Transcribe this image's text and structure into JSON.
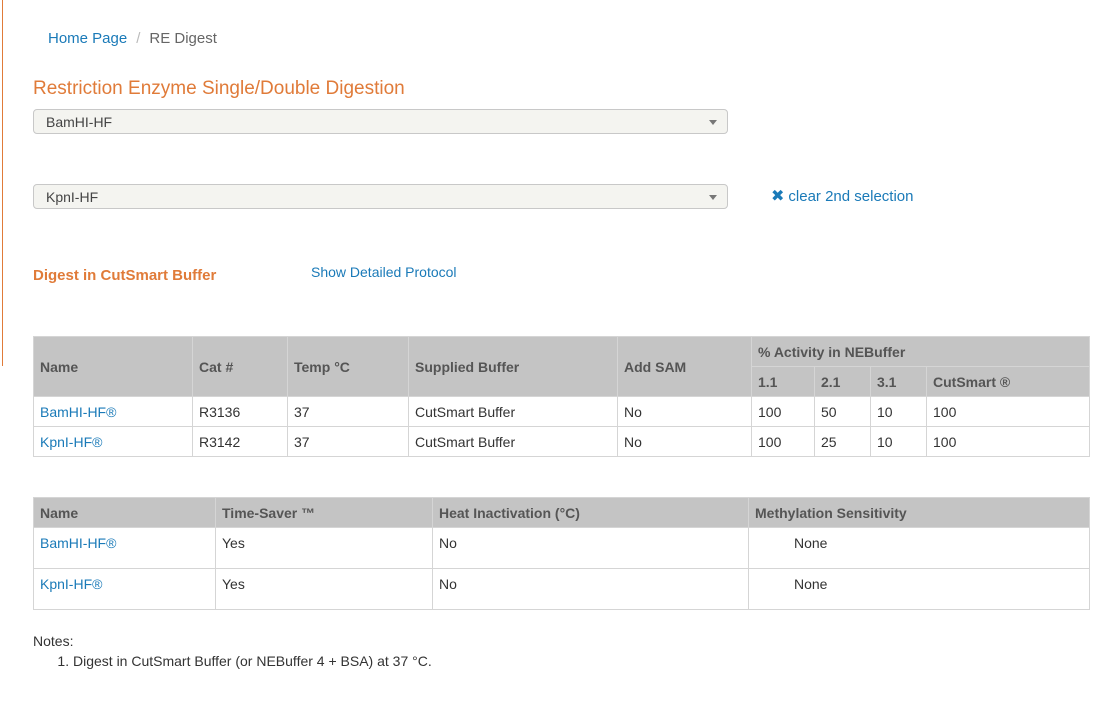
{
  "breadcrumb": {
    "home": "Home Page",
    "separator": "/",
    "current": "RE Digest"
  },
  "page_title": "Restriction Enzyme Single/Double Digestion",
  "selects": {
    "first": "BamHI-HF",
    "second": "KpnI-HF"
  },
  "clear_link": {
    "icon": "✖",
    "label": "clear 2nd selection"
  },
  "digest_title": "Digest in CutSmart Buffer",
  "protocol_link": "Show Detailed Protocol",
  "table1": {
    "headers": {
      "name": "Name",
      "cat": "Cat #",
      "temp": "Temp °C",
      "buffer": "Supplied Buffer",
      "sam": "Add SAM",
      "activity": "% Activity in NEBuffer",
      "b11": "1.1",
      "b21": "2.1",
      "b31": "3.1",
      "cutsmart": "CutSmart ®"
    },
    "rows": [
      {
        "name": "BamHI-HF®",
        "cat": "R3136",
        "temp": "37",
        "buffer": "CutSmart Buffer",
        "sam": "No",
        "b11": "100",
        "b21": "50",
        "b31": "10",
        "cutsmart": "100"
      },
      {
        "name": "KpnI-HF®",
        "cat": "R3142",
        "temp": "37",
        "buffer": "CutSmart Buffer",
        "sam": "No",
        "b11": "100",
        "b21": "25",
        "b31": "10",
        "cutsmart": "100"
      }
    ]
  },
  "table2": {
    "headers": {
      "name": "Name",
      "timesaver": "Time-Saver ™",
      "heat": "Heat Inactivation (°C)",
      "methylation": "Methylation Sensitivity"
    },
    "rows": [
      {
        "name": "BamHI-HF®",
        "timesaver": "Yes",
        "heat": "No",
        "methylation": "None"
      },
      {
        "name": "KpnI-HF®",
        "timesaver": "Yes",
        "heat": "No",
        "methylation": "None"
      }
    ]
  },
  "notes": {
    "label": "Notes:",
    "items": [
      "Digest in CutSmart Buffer (or NEBuffer 4 + BSA) at 37 °C."
    ]
  }
}
